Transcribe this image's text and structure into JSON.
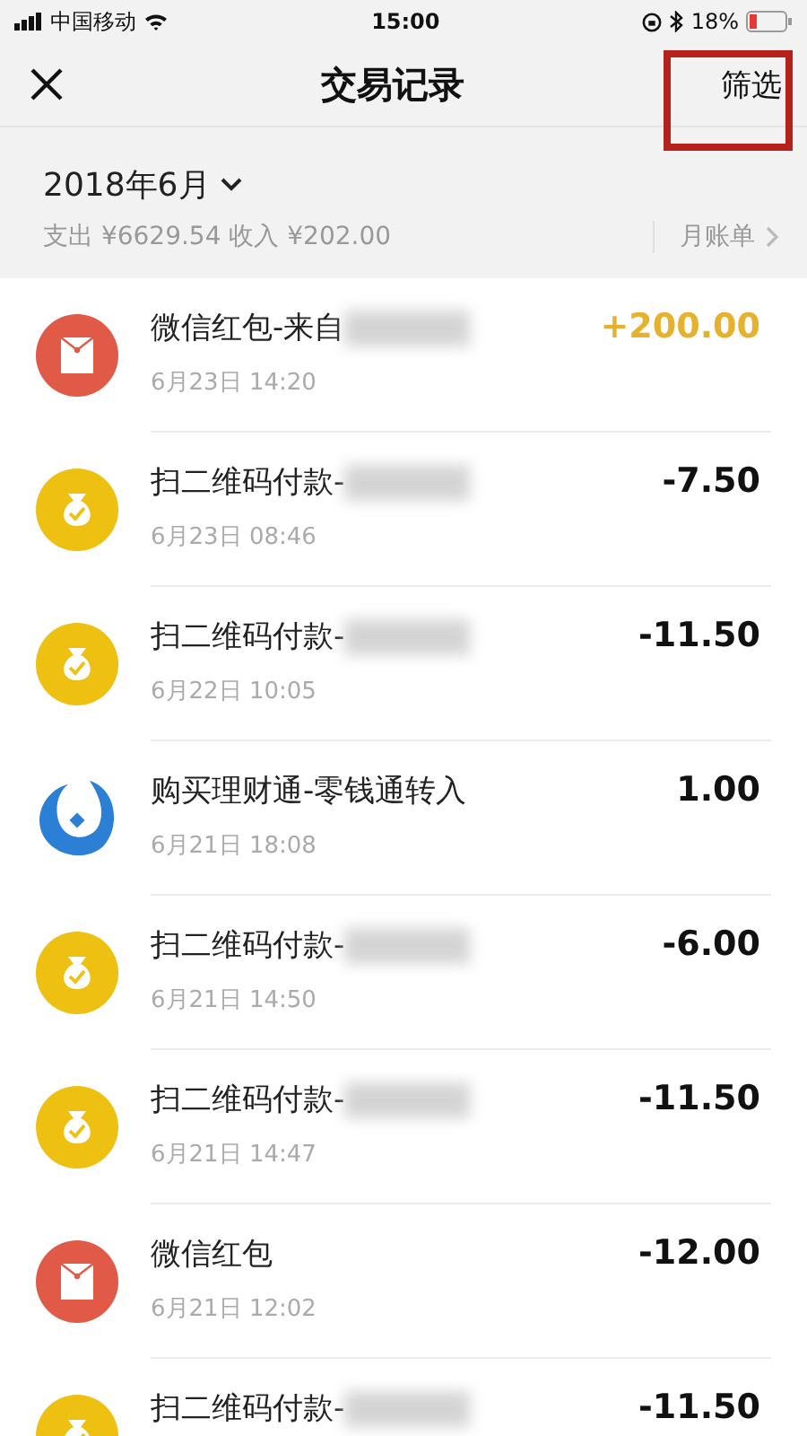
{
  "status_bar": {
    "carrier": "中国移动",
    "time": "15:00",
    "battery": "18%"
  },
  "nav": {
    "title": "交易记录",
    "filter": "筛选",
    "filter_highlighted": true
  },
  "summary": {
    "month": "2018年6月",
    "totals": "支出 ¥6629.54 收入 ¥202.00",
    "monthly_bill": "月账单"
  },
  "transactions": [
    {
      "kind": "red-packet",
      "title": "微信红包-来自",
      "blurred": true,
      "time": "6月23日 14:20",
      "amount": "+200.00",
      "income": true
    },
    {
      "kind": "money-bag",
      "title": "扫二维码付款-",
      "blurred": true,
      "time": "6月23日 08:46",
      "amount": "-7.50",
      "income": false
    },
    {
      "kind": "money-bag",
      "title": "扫二维码付款-",
      "blurred": true,
      "time": "6月22日 10:05",
      "amount": "-11.50",
      "income": false
    },
    {
      "kind": "wealth",
      "title": "购买理财通-零钱通转入",
      "blurred": false,
      "time": "6月21日 18:08",
      "amount": "1.00",
      "income": false
    },
    {
      "kind": "money-bag",
      "title": "扫二维码付款-",
      "blurred": true,
      "time": "6月21日 14:50",
      "amount": "-6.00",
      "income": false
    },
    {
      "kind": "money-bag",
      "title": "扫二维码付款-",
      "blurred": true,
      "time": "6月21日 14:47",
      "amount": "-11.50",
      "income": false
    },
    {
      "kind": "red-packet",
      "title": "微信红包",
      "blurred": false,
      "time": "6月21日 12:02",
      "amount": "-12.00",
      "income": false
    },
    {
      "kind": "money-bag",
      "title": "扫二维码付款-",
      "blurred": true,
      "amount": "-11.50",
      "income": false
    }
  ]
}
